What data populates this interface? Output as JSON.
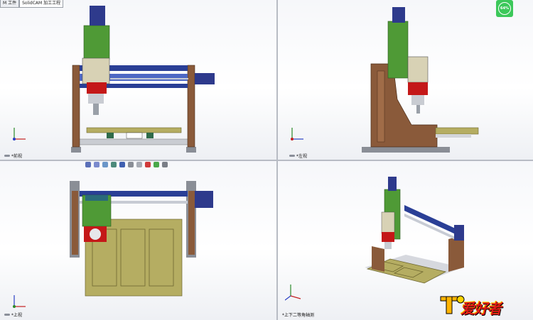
{
  "tabs": [
    "M 工件",
    "SolidCAM 加工工程"
  ],
  "views": {
    "front": "*前视",
    "left": "*左视",
    "top": "*上视",
    "iso": "*上下二等角轴测"
  },
  "badge_text": "64%",
  "logo_text": "爱好者",
  "colors": {
    "wood": "#8a5a3a",
    "rail_blue": "#2a3f96",
    "spindle_green": "#4f9a36",
    "spindle_red": "#c41818",
    "bed": "#b5ad62",
    "base_gray": "#8a8e96",
    "motor": "#2e3a8c"
  },
  "toolbar_icons": [
    "zoom-fit-icon",
    "zoom-area-icon",
    "previous-view-icon",
    "section-view-icon",
    "view-orientation-icon",
    "display-style-icon",
    "hide-show-icon",
    "appearance-icon",
    "scene-icon",
    "view-settings-icon"
  ]
}
